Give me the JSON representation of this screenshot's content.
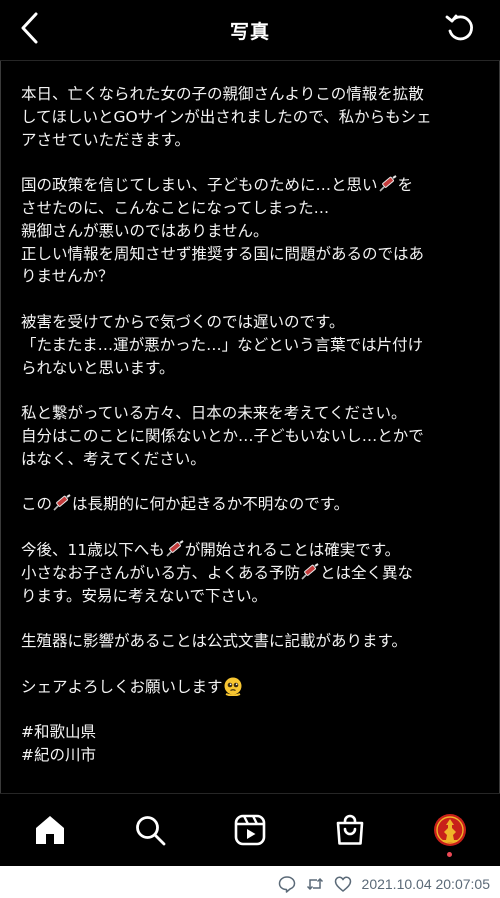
{
  "header": {
    "title": "写真",
    "back_icon": "chevron-left-icon",
    "refresh_icon": "refresh-icon"
  },
  "post": {
    "paragraphs": [
      [
        "本日、亡くなられた女の子の親御さんよりこの情報を拡散",
        "してほしいとGOサインが出されましたので、私からもシェ",
        "アさせていただきます。"
      ],
      [
        "国の政策を信じてしまい、子どものために…と思い",
        "させたのに、こんなことになってしまった…",
        "親御さんが悪いのではありません。",
        "正しい情報を周知させず推奨する国に問題があるのではあ",
        "りませんか？"
      ],
      [
        "被害を受けてからで気づくのでは遅いのです。",
        "「たまたま…運が悪かった…」などという言葉では片付け",
        "られないと思います。"
      ],
      [
        "私と繋がっている方々、日本の未来を考えてください。",
        "自分はこのことに関係ないとか…子どもいないし…とかで",
        "はなく、考えてください。"
      ],
      [
        "この",
        "は長期的に何か起きるか不明なのです。"
      ],
      [
        "今後、11歳以下へも",
        "が開始されることは確実です。",
        "小さなお子さんがいる方、よくある予防",
        "とは全く異な",
        "ります。安易に考えないで下さい。"
      ],
      [
        "生殖器に影響があることは公式文書に記載があります。"
      ],
      [
        "シェアよろしくお願いします"
      ]
    ],
    "tail_after_syringe_1": "を",
    "emoji_syringe": "syringe-icon",
    "emoji_face": "pleading-face-icon",
    "hashtags": [
      "#和歌山県",
      "#紀の川市"
    ]
  },
  "tabbar": {
    "items": [
      {
        "icon": "home-icon"
      },
      {
        "icon": "search-icon"
      },
      {
        "icon": "reels-icon"
      },
      {
        "icon": "shop-icon"
      },
      {
        "icon": "profile-avatar-icon"
      }
    ],
    "accent": "#ed4956"
  },
  "tweet_meta": {
    "timestamp": "2021.10.04 20:07:05",
    "icons": [
      "reply-icon",
      "retweet-icon",
      "like-icon"
    ]
  },
  "colors": {
    "background": "#000000",
    "text": "#f4f4f4",
    "meta": "#5b6a78"
  }
}
